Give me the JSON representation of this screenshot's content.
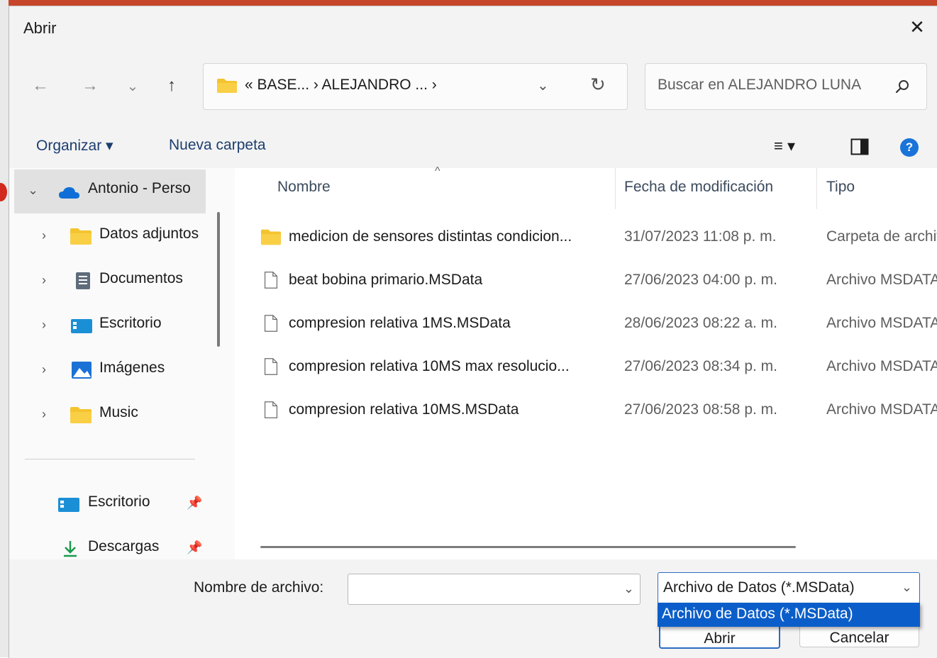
{
  "dialog": {
    "title": "Abrir",
    "close_glyph": "✕"
  },
  "nav": {
    "back": "←",
    "forward": "→",
    "recent": "⌄",
    "up": "↑",
    "address": {
      "text": "« BASE... › ALEJANDRO ... ›",
      "dropdown": "⌄",
      "refresh": "↻"
    },
    "search_placeholder": "Buscar en ALEJANDRO LUNA"
  },
  "toolbar": {
    "organize": "Organizar ▾",
    "new_folder": "Nueva carpeta",
    "view_menu": "≡ ▾",
    "help": "?"
  },
  "sidebar": {
    "top": {
      "label": "Antonio - Perso",
      "chevron": "⌄"
    },
    "items": [
      {
        "label": "Datos adjuntos",
        "icon": "folder-icon",
        "chevron": "›"
      },
      {
        "label": "Documentos",
        "icon": "documents-icon",
        "chevron": "›"
      },
      {
        "label": "Escritorio",
        "icon": "desktop-icon",
        "chevron": "›"
      },
      {
        "label": "Imágenes",
        "icon": "pictures-icon",
        "chevron": "›"
      },
      {
        "label": "Music",
        "icon": "folder-icon",
        "chevron": "›"
      }
    ],
    "quick": [
      {
        "label": "Escritorio",
        "icon": "desktop-icon",
        "pin": "📌"
      },
      {
        "label": "Descargas",
        "icon": "download-icon",
        "pin": "📌"
      }
    ]
  },
  "list": {
    "columns": {
      "name": "Nombre",
      "date": "Fecha de modificación",
      "type": "Tipo"
    },
    "sort_glyph": "^",
    "rows": [
      {
        "name": "medicion de sensores distintas condicion...",
        "date": "31/07/2023 11:08 p. m.",
        "type": "Carpeta de archivos",
        "kind": "folder"
      },
      {
        "name": "beat bobina primario.MSData",
        "date": "27/06/2023 04:00 p. m.",
        "type": "Archivo MSDATA",
        "kind": "file"
      },
      {
        "name": "compresion relativa 1MS.MSData",
        "date": "28/06/2023 08:22 a. m.",
        "type": "Archivo MSDATA",
        "kind": "file"
      },
      {
        "name": "compresion relativa 10MS max resolucio...",
        "date": "27/06/2023 08:34 p. m.",
        "type": "Archivo MSDATA",
        "kind": "file"
      },
      {
        "name": "compresion relativa 10MS.MSData",
        "date": "27/06/2023 08:58 p. m.",
        "type": "Archivo MSDATA",
        "kind": "file"
      }
    ]
  },
  "footer": {
    "filename_label": "Nombre de archivo:",
    "filename_value": "",
    "filetype_selected": "Archivo de Datos (*.MSData)",
    "filetype_option": "Archivo de Datos (*.MSData)",
    "dropdown_glyph": "⌄",
    "open_label": "Abrir",
    "cancel_label": "Cancelar"
  },
  "colors": {
    "accent": "#0b5ec9",
    "folder": "#f4c430",
    "help": "#1a73d9"
  }
}
